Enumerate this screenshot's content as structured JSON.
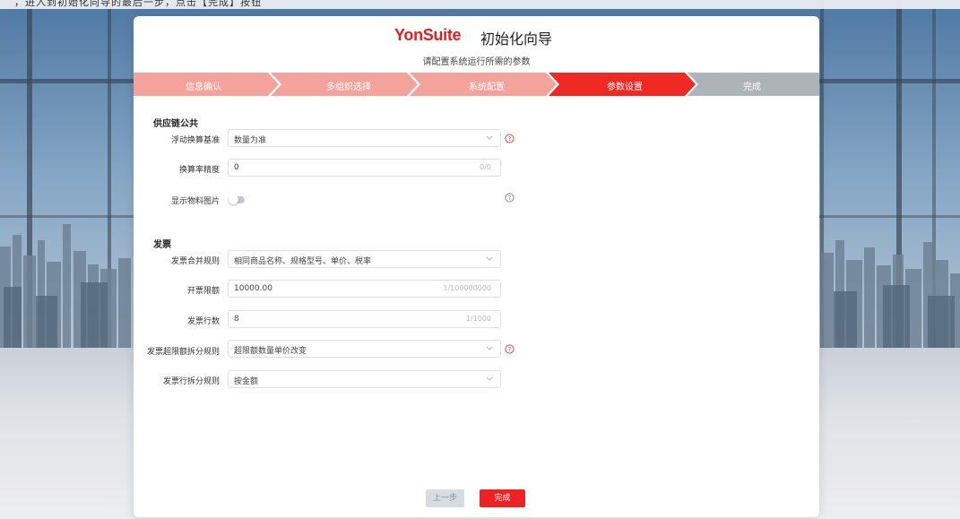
{
  "top_note": "，进入到初始化向导的最后一步，点击【完成】按钮",
  "header": {
    "logo_yon": "Yon",
    "logo_suite": "Suite",
    "title": "初始化向导",
    "subtitle": "请配置系统运行所需的参数"
  },
  "steps": [
    {
      "label": "信息确认",
      "state": "done"
    },
    {
      "label": "多组织选择",
      "state": "done"
    },
    {
      "label": "系统配置",
      "state": "done"
    },
    {
      "label": "参数设置",
      "state": "active"
    },
    {
      "label": "完成",
      "state": "pending"
    }
  ],
  "colors": {
    "done_step": "#f4a39c",
    "active_step": "#ee2a22",
    "pending_step": "#aeb2b9",
    "brand": "#e02020"
  },
  "sections": {
    "supply_chain": {
      "title": "供应链公共",
      "rows": {
        "float_basis": {
          "label": "浮动换算基准",
          "value": "数量为准"
        },
        "precision": {
          "label": "换算率精度",
          "value": "0",
          "counter": "0/0"
        },
        "show_image": {
          "label": "显示物料图片",
          "value": false
        }
      }
    },
    "invoice": {
      "title": "发票",
      "rows": {
        "merge_rule": {
          "label": "发票合并规则",
          "value": "相同商品名称、规格型号、单价、税率"
        },
        "limit": {
          "label": "开票限额",
          "value": "10000.00",
          "counter": "1/100000000"
        },
        "lines": {
          "label": "发票行数",
          "value": "8",
          "counter": "1/1000"
        },
        "over_limit_split": {
          "label": "发票超限额拆分规则",
          "value": "超限额数量单价改变"
        },
        "line_split": {
          "label": "发票行拆分规则",
          "value": "按金额"
        }
      }
    }
  },
  "footer": {
    "prev_label": "上一步",
    "done_label": "完成"
  }
}
